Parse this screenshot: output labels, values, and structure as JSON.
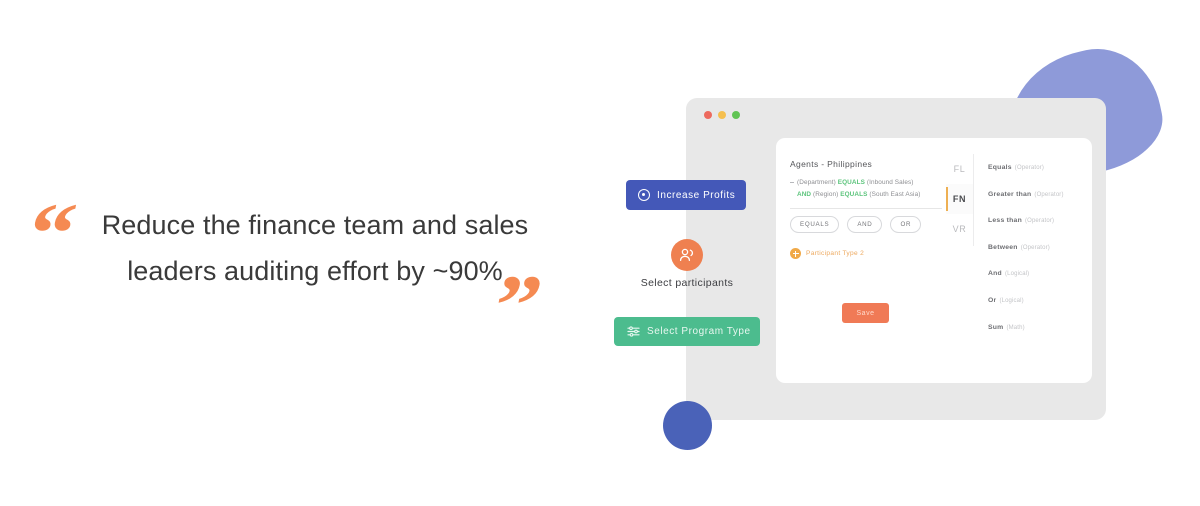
{
  "quote": {
    "open_mark": "“",
    "close_mark": "”",
    "line1": "Reduce the finance team and sales",
    "line2": "leaders auditing effort by ~90%",
    "accent_color": "#f58a52",
    "text_color": "#3a3a3a"
  },
  "decor": {
    "blob_color": "#8e9ad9",
    "circle_color": "#4a62b8"
  },
  "window": {
    "chrome_dots": [
      {
        "name": "close",
        "color": "#ed6a5e"
      },
      {
        "name": "minimize",
        "color": "#f5bf4f"
      },
      {
        "name": "maximize",
        "color": "#61c454"
      }
    ],
    "background": "#e8e8e8"
  },
  "card": {
    "rule_title": "Agents - Philippines",
    "rule_rows": [
      {
        "prefix": "",
        "field": "(Department)",
        "operator": "EQUALS",
        "value": "(Inbound Sales)"
      },
      {
        "prefix": "AND",
        "field": "(Region)",
        "operator": "EQUALS",
        "value": "(South East Asia)"
      }
    ],
    "chips": [
      "EQUALS",
      "AND",
      "OR"
    ],
    "participant_type": {
      "icon": "plus-circle-icon",
      "label": "Participant Type 2"
    },
    "save_label": "Save",
    "save_color": "#f07a56",
    "tabs": [
      {
        "id": "FL",
        "label": "FL",
        "active": false
      },
      {
        "id": "FN",
        "label": "FN",
        "active": true
      },
      {
        "id": "VR",
        "label": "VR",
        "active": false
      }
    ],
    "operators": [
      {
        "name": "Equals",
        "kind": "(Operator)"
      },
      {
        "name": "Greater than",
        "kind": "(Operator)"
      },
      {
        "name": "Less than",
        "kind": "(Operator)"
      },
      {
        "name": "Between",
        "kind": "(Operator)"
      },
      {
        "name": "And",
        "kind": "(Logical)"
      },
      {
        "name": "Or",
        "kind": "(Logical)"
      },
      {
        "name": "Sum",
        "kind": "(Math)"
      }
    ]
  },
  "floating": {
    "increase_profits": {
      "label": "Increase Profits",
      "icon": "target-icon",
      "color": "#4458b8"
    },
    "select_participants": {
      "label": "Select participants",
      "icon": "users-icon",
      "color": "#ef8050"
    },
    "select_program_type": {
      "label": "Select Program Type",
      "icon": "sliders-icon",
      "color": "#4cbc8e"
    }
  }
}
